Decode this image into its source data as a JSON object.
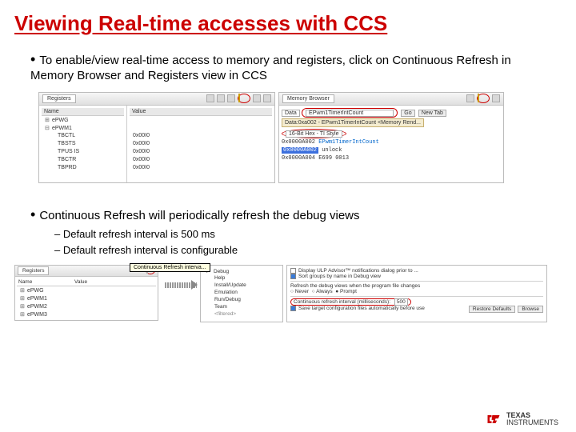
{
  "title": "Viewing Real-time accesses with CCS",
  "bullets": {
    "b1": "To enable/view real-time access to memory and registers, click on Continuous Refresh in Memory Browser and Registers view in CCS",
    "b2": "Continuous Refresh will periodically refresh the debug views",
    "sub1": "Default refresh interval is 500 ms",
    "sub2": "Default refresh interval is configurable"
  },
  "shot1": {
    "registers": {
      "tab": "Registers",
      "col_name": "Name",
      "col_value": "Value",
      "tree": [
        "ePWG",
        "ePWM1",
        "TBCTL",
        "TBSTS",
        "TPUS IS",
        "TBCTR",
        "TBPRD"
      ],
      "values": [
        "0x00I0",
        "0x00I0",
        "0x00I0",
        "0x00I0",
        "0x00I0"
      ]
    },
    "memory": {
      "tab": "Memory Browser",
      "data_lbl": "Data",
      "addr": "EPwm1TimerIntCount",
      "go": "Go",
      "newtab": "New Tab",
      "path": "Data:0xa002 - EPwm1TimerIntCount <Memory Rend...",
      "style": "16-Bit Hex - TI Style",
      "lines": [
        {
          "addr": "0x0000A002",
          "label": "EPwm1TimerIntCount"
        },
        {
          "addr": "0x0000A002",
          "text": "unlock"
        },
        {
          "addr": "0x0000A004",
          "text": "E699 0013"
        }
      ]
    }
  },
  "shot2": {
    "registers": {
      "tab": "Registers",
      "col_name": "Name",
      "col_value": "Value",
      "tree": [
        "ePWG",
        "ePWM1",
        "ePWM2",
        "ePWM3"
      ]
    },
    "tooltip": "Continuous Refresh interva...",
    "tree": [
      "Debug",
      "Help",
      "Install/Update",
      "Emulation",
      "Run/Debug",
      "Team",
      "<filtered>"
    ],
    "prefs": {
      "opt1": "Display ULP Advisor™ notifications dialog prior to ...",
      "opt2": "Sort groups by name in Debug view",
      "section": "Refresh the debug views when the program file changes",
      "never": "Never",
      "always": "Always",
      "prompt": "Prompt",
      "cri_label": "Continuous refresh interval (milliseconds):",
      "cri_value": "500",
      "save": "Save target configuration files automatically before use",
      "restore": "Restore Defaults",
      "browse": "Browse"
    }
  },
  "logo": {
    "line1": "TEXAS",
    "line2": "INSTRUMENTS"
  }
}
